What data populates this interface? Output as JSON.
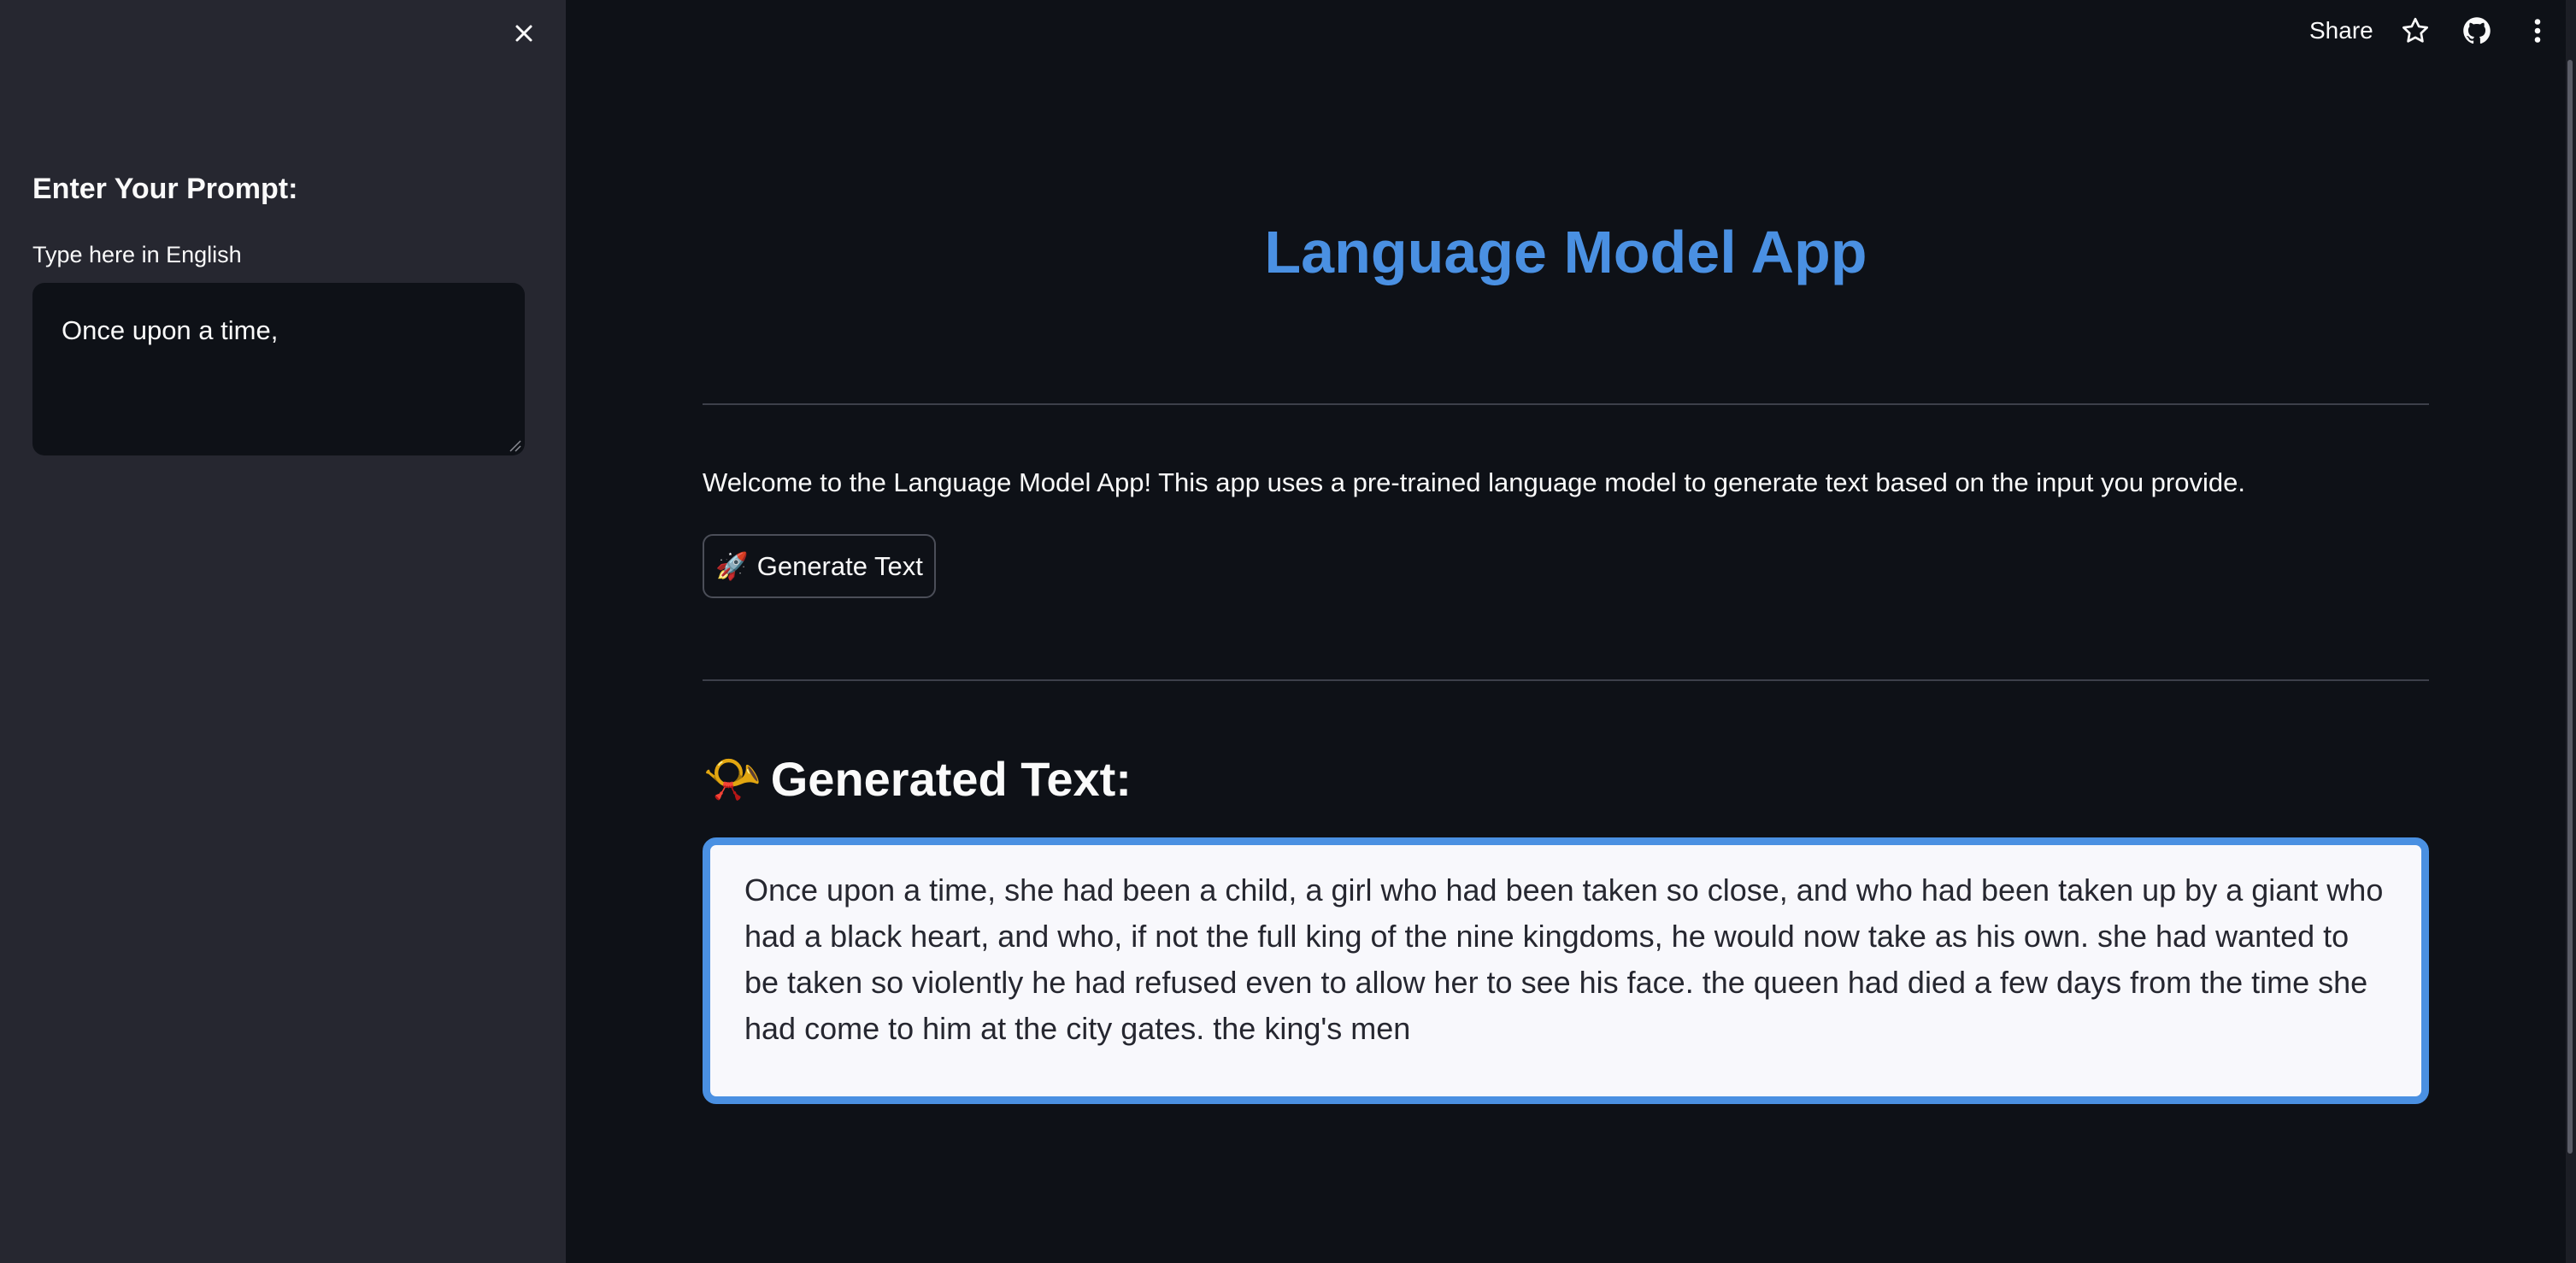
{
  "sidebar": {
    "heading": "Enter Your Prompt:",
    "input_label": "Type here in English",
    "input_value": "Once upon a time,",
    "close_icon": "close-icon"
  },
  "header": {
    "share_label": "Share",
    "icons": [
      "star-icon",
      "github-icon",
      "kebab-menu-icon"
    ]
  },
  "main": {
    "title": "Language Model App",
    "welcome": "Welcome to the Language Model App! This app uses a pre-trained language model to generate text based on the input you provide.",
    "generate_button": {
      "icon": "🚀",
      "label": "Generate Text"
    },
    "section_title": {
      "icon": "📯",
      "label": "Generated Text:"
    },
    "output_text": "Once upon a time, she had been a child, a girl who had been taken so close, and who had been taken up by a giant who had a black heart, and who, if not the full king of the nine kingdoms, he would now take as his own. she had wanted to be taken so violently he had refused even to allow her to see his face. the queen had died a few days from the time she had come to him at the city gates. the king's men"
  },
  "colors": {
    "background": "#0e1117",
    "sidebar": "#262730",
    "accent": "#4a90e2",
    "text": "#fafafa",
    "output_bg": "#f8f8fc"
  }
}
